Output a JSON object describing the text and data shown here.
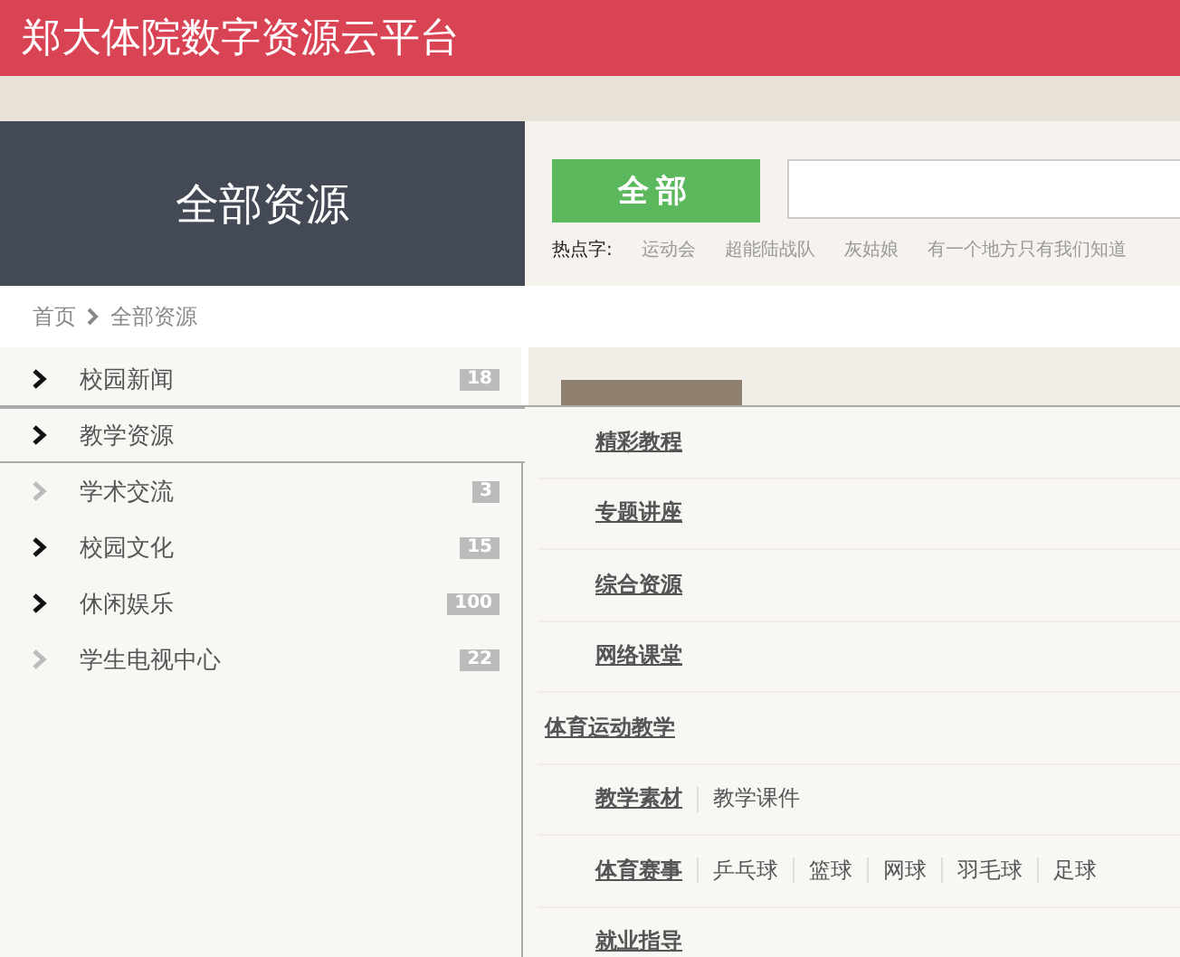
{
  "header": {
    "title": "郑大体院数字资源云平台"
  },
  "banner": {
    "title": "全部资源"
  },
  "search": {
    "scope_button": "全部",
    "hot_label": "热点字:",
    "hot_words": [
      "运动会",
      "超能陆战队",
      "灰姑娘",
      "有一个地方只有我们知道"
    ]
  },
  "breadcrumb": [
    "首页",
    "全部资源"
  ],
  "sidebar": {
    "items": [
      {
        "label": "校园新闻",
        "count": "18",
        "has_children": true,
        "expanded": false
      },
      {
        "label": "教学资源",
        "has_children": true,
        "expanded": true
      },
      {
        "label": "学术交流",
        "count": "3",
        "has_children": false,
        "expanded": false
      },
      {
        "label": "校园文化",
        "count": "15",
        "has_children": true,
        "expanded": false
      },
      {
        "label": "休闲娱乐",
        "count": "100",
        "has_children": true,
        "expanded": false
      },
      {
        "label": "学生电视中心",
        "count": "22",
        "has_children": false,
        "expanded": false
      }
    ]
  },
  "submenu": {
    "items": [
      {
        "kind": "subgroup",
        "label": "精彩教程"
      },
      {
        "kind": "subgroup",
        "label": "专题讲座"
      },
      {
        "kind": "subgroup",
        "label": "综合资源"
      },
      {
        "kind": "subgroup",
        "label": "网络课堂"
      },
      {
        "kind": "group",
        "label": "体育运动教学"
      },
      {
        "kind": "subgroup",
        "label": "教学素材",
        "links": [
          "教学课件"
        ]
      },
      {
        "kind": "subgroup",
        "label": "体育赛事",
        "links": [
          "乒乓球",
          "篮球",
          "网球",
          "羽毛球",
          "足球"
        ]
      },
      {
        "kind": "subgroup",
        "label": "就业指导"
      }
    ]
  }
}
